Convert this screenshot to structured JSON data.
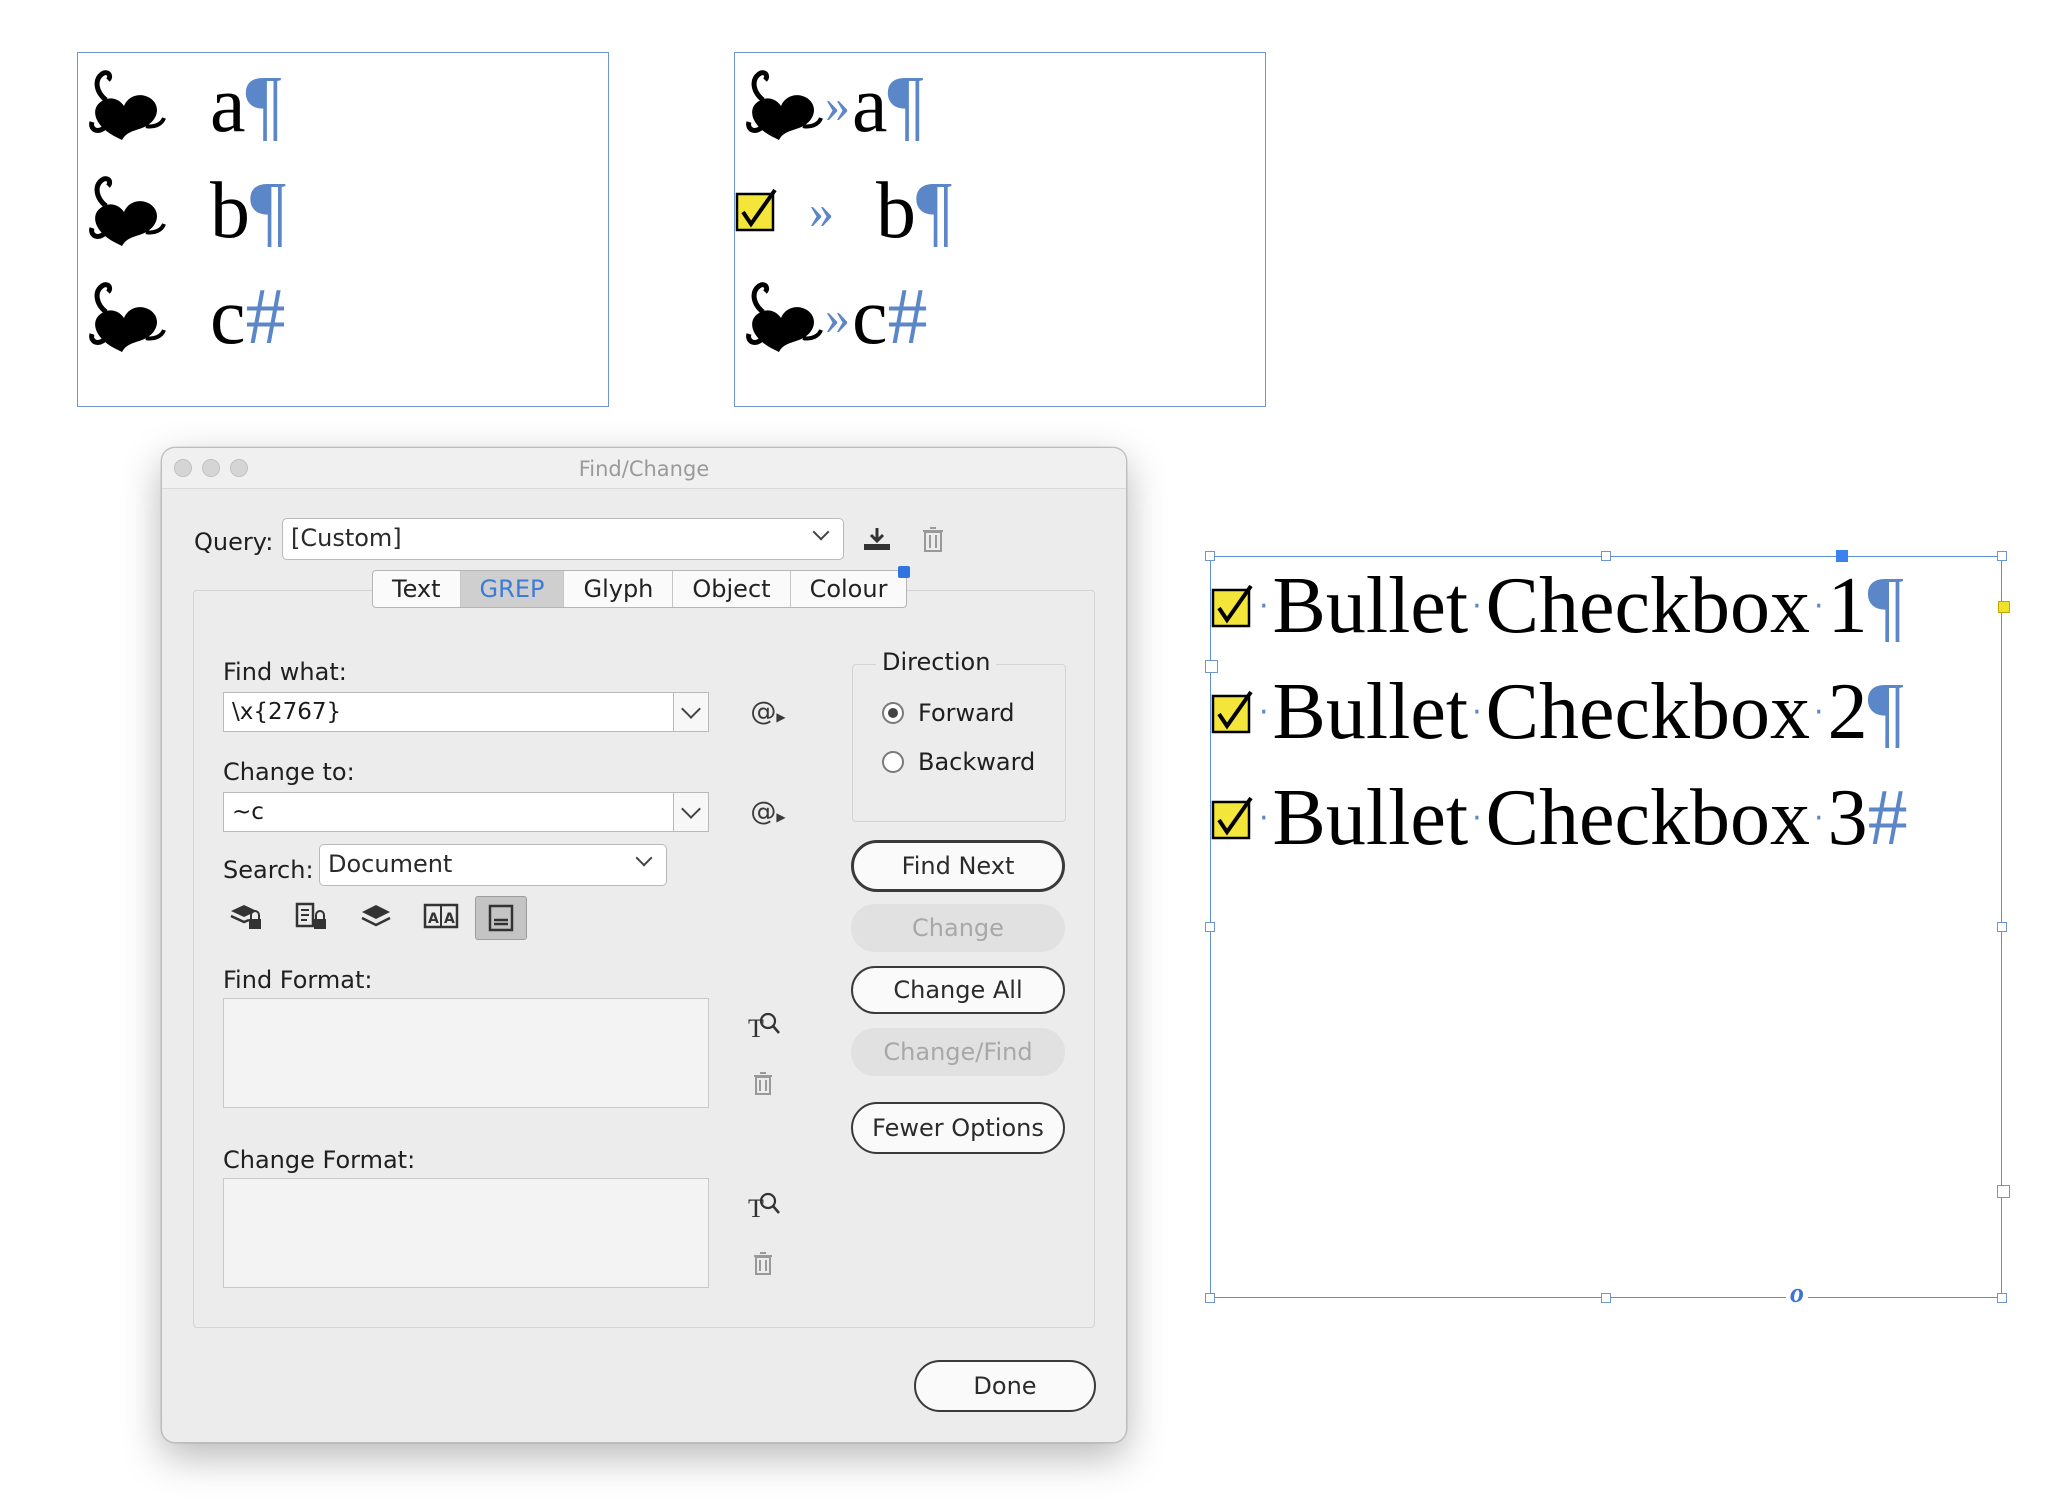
{
  "frames": {
    "left": {
      "lines": [
        {
          "char": "a",
          "end": "¶"
        },
        {
          "char": "b",
          "end": "¶"
        },
        {
          "char": "c",
          "end": "#"
        }
      ]
    },
    "middle": {
      "lines": [
        {
          "tab": "»",
          "char": "a",
          "end": "¶"
        },
        {
          "tab": "»",
          "char": "b",
          "end": "¶"
        },
        {
          "tab": "»",
          "char": "c",
          "end": "#"
        }
      ]
    },
    "right": {
      "lines": [
        {
          "w1": "Bullet",
          "w2": "Checkbox",
          "num": "1",
          "end": "¶"
        },
        {
          "w1": "Bullet",
          "w2": "Checkbox",
          "num": "2",
          "end": "¶"
        },
        {
          "w1": "Bullet",
          "w2": "Checkbox",
          "num": "3",
          "end": "#"
        }
      ],
      "space_mark": "·",
      "overset_mark": "o"
    }
  },
  "dialog": {
    "title": "Find/Change",
    "query_label": "Query:",
    "query_value": "[Custom]",
    "tabs": [
      "Text",
      "GREP",
      "Glyph",
      "Object",
      "Colour"
    ],
    "selected_tab": "GREP",
    "find_what_label": "Find what:",
    "find_what_value": "\\x{2767}",
    "change_to_label": "Change to:",
    "change_to_value": "~c",
    "search_label": "Search:",
    "search_value": "Document",
    "find_format_label": "Find Format:",
    "change_format_label": "Change Format:",
    "direction_label": "Direction",
    "direction_options": [
      "Forward",
      "Backward"
    ],
    "direction_selected": "Forward",
    "buttons": {
      "find_next": "Find Next",
      "change": "Change",
      "change_all": "Change All",
      "change_find": "Change/Find",
      "fewer_options": "Fewer Options",
      "done": "Done"
    },
    "special_char_symbol": "@"
  },
  "colors": {
    "frame_border": "#6f95cf",
    "hidden_chars": "#5b86c8",
    "selected_tab_text": "#3d7bd9",
    "checkbox_fill": "#f3e53a"
  }
}
